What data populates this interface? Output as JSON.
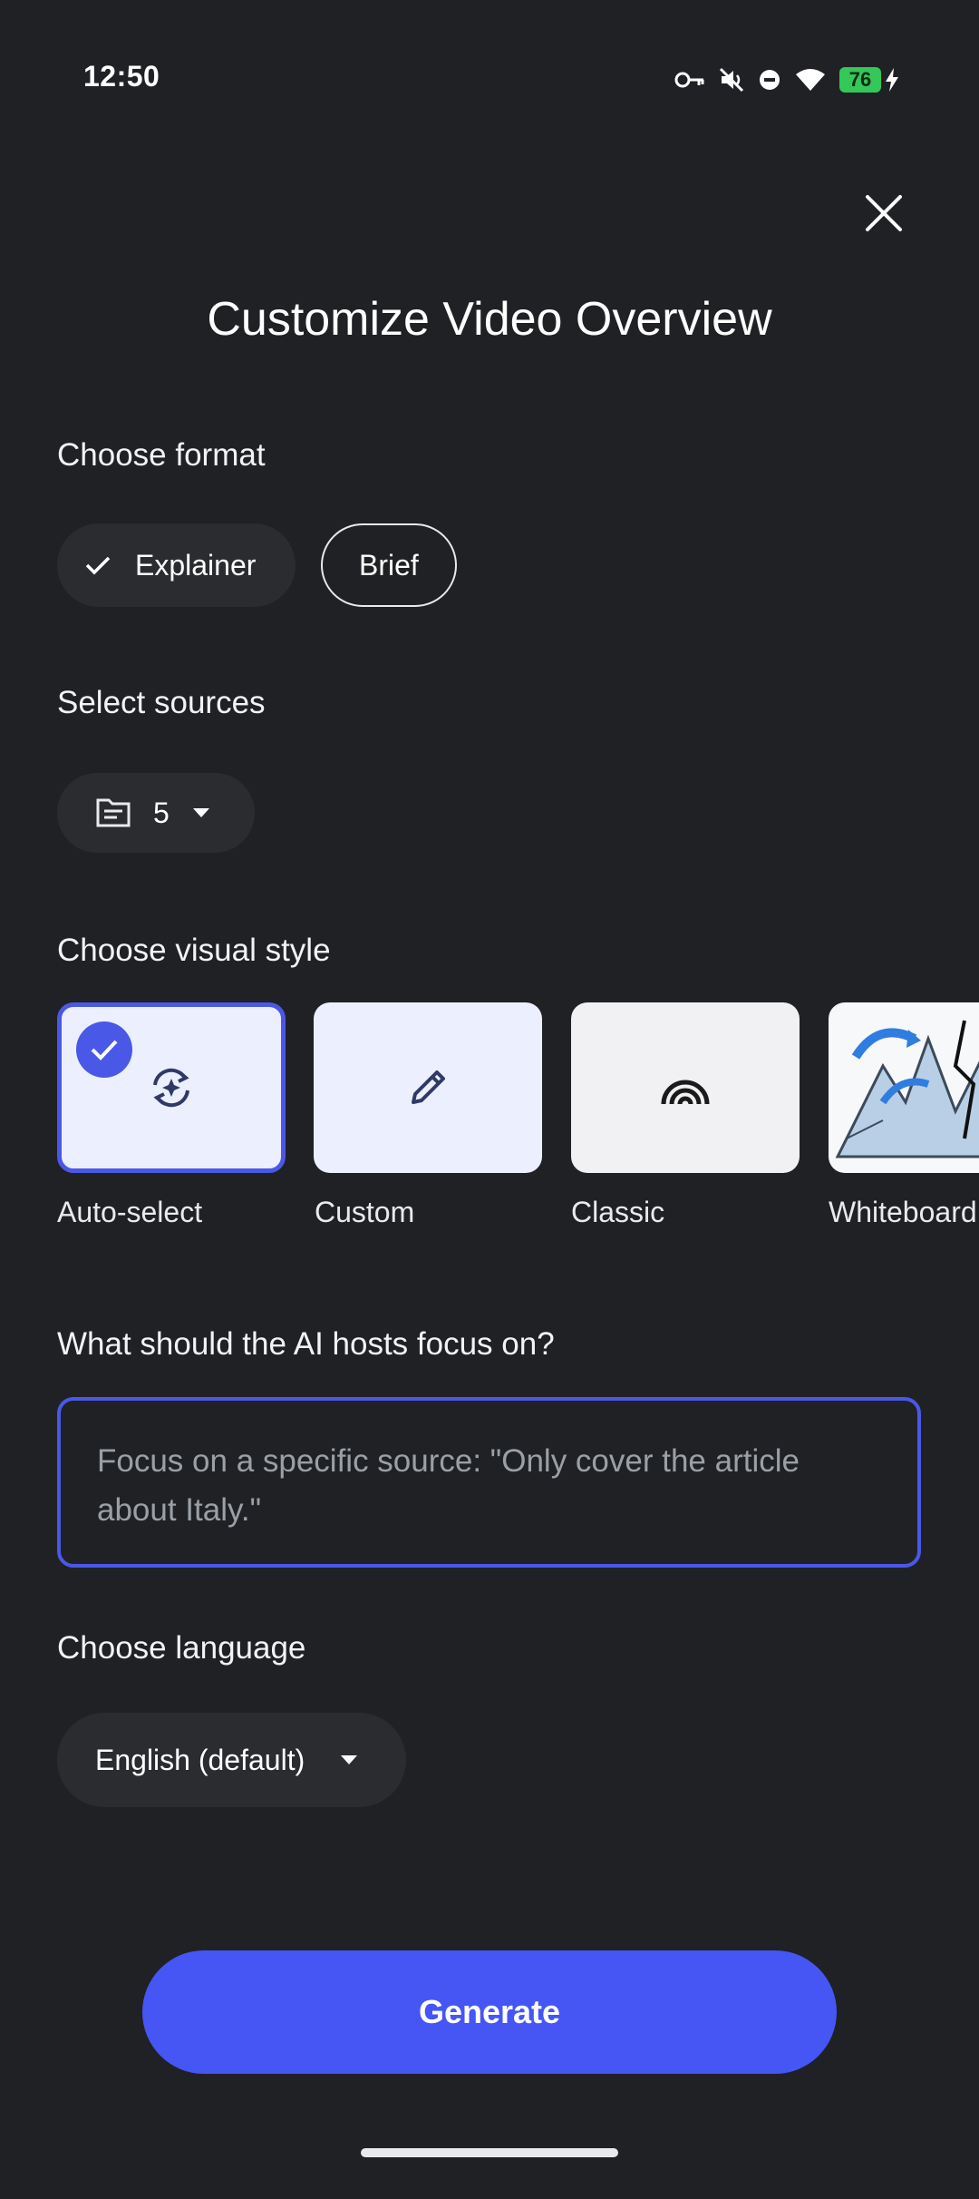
{
  "status_bar": {
    "time": "12:50",
    "battery_level": "76",
    "icons": [
      "key-icon",
      "mute-icon",
      "do-not-disturb-icon",
      "wifi-icon",
      "battery-icon",
      "charging-icon"
    ]
  },
  "header": {
    "title": "Customize Video Overview",
    "close_icon": "close-icon"
  },
  "format": {
    "label": "Choose format",
    "options": [
      {
        "label": "Explainer",
        "selected": true
      },
      {
        "label": "Brief",
        "selected": false
      }
    ]
  },
  "sources": {
    "label": "Select sources",
    "count": "5"
  },
  "visual_style": {
    "label": "Choose visual style",
    "options": [
      {
        "label": "Auto-select",
        "icon": "auto-select-icon",
        "selected": true
      },
      {
        "label": "Custom",
        "icon": "pencil-icon",
        "selected": false
      },
      {
        "label": "Classic",
        "icon": "classic-arcs-icon",
        "selected": false
      },
      {
        "label": "Whiteboard",
        "icon": "whiteboard-thumbnail",
        "selected": false
      }
    ]
  },
  "focus": {
    "label": "What should the AI hosts focus on?",
    "placeholder": "Focus on a specific source: \"Only cover the article about Italy.\""
  },
  "language": {
    "label": "Choose language",
    "selected": "English (default)"
  },
  "actions": {
    "generate_label": "Generate"
  },
  "colors": {
    "background": "#202124",
    "accent": "#4556f5",
    "chip_bg": "#2a2c30",
    "selected_border": "#4a58e8"
  }
}
